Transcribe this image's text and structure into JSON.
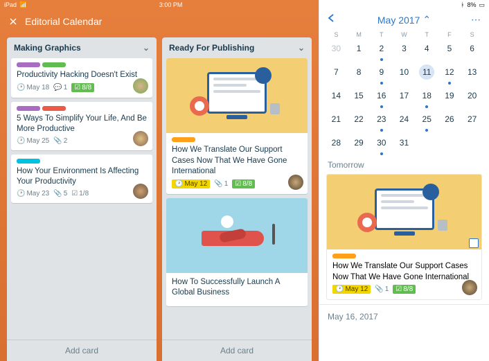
{
  "status": {
    "device": "iPad",
    "time": "3:00 PM",
    "battery": "8%"
  },
  "board": {
    "title": "Editorial Calendar",
    "lists": [
      {
        "name": "Making Graphics",
        "add": "Add card",
        "cards": [
          {
            "title": "Productivity Hacking Doesn't Exist",
            "due": "May 18",
            "comments": "1",
            "check": "8/8",
            "labels": [
              "#a86cc1",
              "#61bd4f"
            ]
          },
          {
            "title": "5 Ways To Simplify Your Life, And Be More Productive",
            "due": "May 25",
            "attach": "2",
            "labels": [
              "#a86cc1",
              "#eb5a46"
            ]
          },
          {
            "title": "How Your Environment Is Affecting Your Productivity",
            "due": "May 23",
            "attach": "5",
            "checkGrey": "1/8",
            "labels": [
              "#00c2e0"
            ]
          }
        ]
      },
      {
        "name": "Ready For Publishing",
        "add": "Add card",
        "cards": [
          {
            "title": "How We Translate Our Support Cases Now That We Have Gone International",
            "due": "May 12",
            "attach": "1",
            "check": "8/8",
            "labels": [
              "#ff9f1a"
            ],
            "cover": "monitor"
          },
          {
            "title": "How To Successfully Launch A Global Business",
            "cover": "plane"
          }
        ]
      }
    ]
  },
  "cal": {
    "title": "May 2017",
    "dow": [
      "S",
      "M",
      "T",
      "W",
      "T",
      "F",
      "S"
    ],
    "weeks": [
      [
        {
          "n": 30,
          "dim": true
        },
        {
          "n": 1
        },
        {
          "n": 2,
          "dot": true
        },
        {
          "n": 3
        },
        {
          "n": 4
        },
        {
          "n": 5
        },
        {
          "n": 6
        }
      ],
      [
        {
          "n": 7
        },
        {
          "n": 8
        },
        {
          "n": 9,
          "dot": true
        },
        {
          "n": 10
        },
        {
          "n": 11,
          "sel": true
        },
        {
          "n": 12,
          "dot": true
        },
        {
          "n": 13
        }
      ],
      [
        {
          "n": 14
        },
        {
          "n": 15
        },
        {
          "n": 16,
          "dot": true
        },
        {
          "n": 17
        },
        {
          "n": 18,
          "dot": true
        },
        {
          "n": 19
        },
        {
          "n": 20
        }
      ],
      [
        {
          "n": 21
        },
        {
          "n": 22
        },
        {
          "n": 23,
          "dot": true
        },
        {
          "n": 24
        },
        {
          "n": 25,
          "dot": true
        },
        {
          "n": 26
        },
        {
          "n": 27
        }
      ],
      [
        {
          "n": 28
        },
        {
          "n": 29
        },
        {
          "n": 30,
          "dot": true
        },
        {
          "n": 31
        },
        {
          "n": "",
          "dim": true
        },
        {
          "n": "",
          "dim": true
        },
        {
          "n": "",
          "dim": true
        }
      ]
    ],
    "section1": "Tomorrow",
    "agenda": {
      "title": "How We Translate Our Support Cases Now That We Have Gone International",
      "due": "May 12",
      "attach": "1",
      "check": "8/8",
      "labels": [
        "#ff9f1a"
      ]
    },
    "section2": "May 16, 2017"
  }
}
